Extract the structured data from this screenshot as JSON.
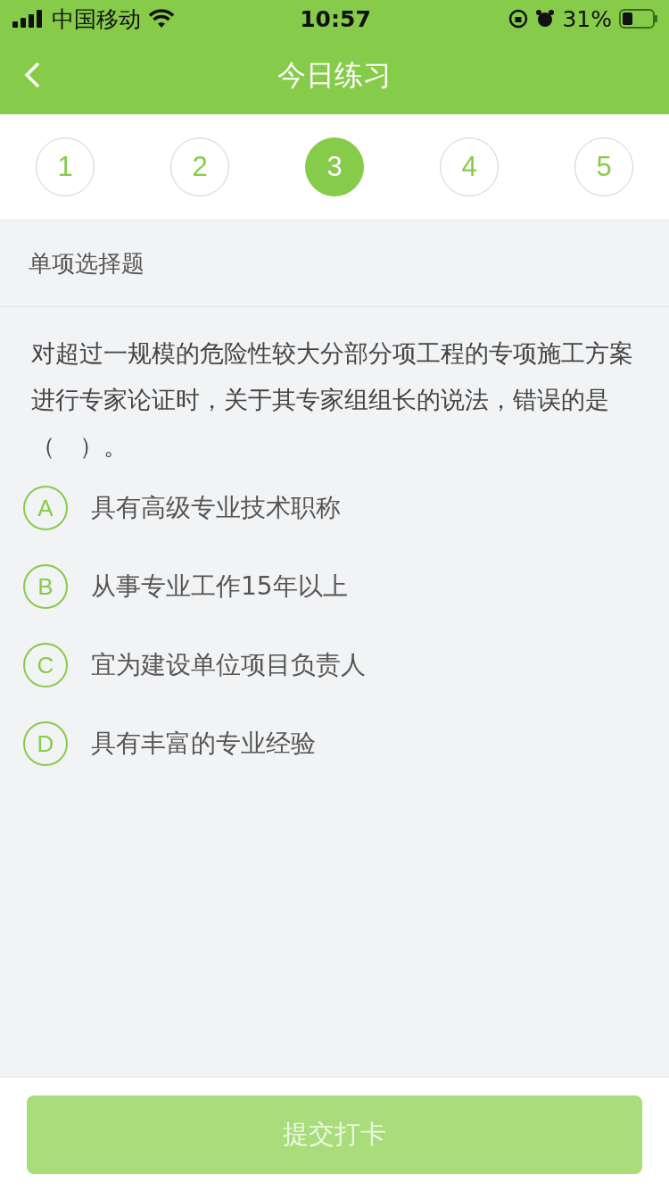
{
  "status_bar": {
    "carrier": "中国移动",
    "time": "10:57",
    "battery": "31%"
  },
  "header": {
    "title": "今日练习"
  },
  "steps": [
    {
      "label": "1",
      "selected": false
    },
    {
      "label": "2",
      "selected": false
    },
    {
      "label": "3",
      "selected": true
    },
    {
      "label": "4",
      "selected": false
    },
    {
      "label": "5",
      "selected": false
    }
  ],
  "section": {
    "title": "单项选择题"
  },
  "question": "对超过一规模的危险性较大分部分项工程的专项施工方案进行专家论证时，关于其专家组组长的说法，错误的是（　）。",
  "options": [
    {
      "letter": "A",
      "text": "具有高级专业技术职称",
      "selected": false
    },
    {
      "letter": "B",
      "text": "从事专业工作15年以上",
      "selected": false
    },
    {
      "letter": "C",
      "text": "宜为建设单位项目负责人",
      "selected": false
    },
    {
      "letter": "D",
      "text": "具有丰富的专业经验",
      "selected": false
    }
  ],
  "submit": {
    "label": "提交打卡",
    "disabled": true
  }
}
